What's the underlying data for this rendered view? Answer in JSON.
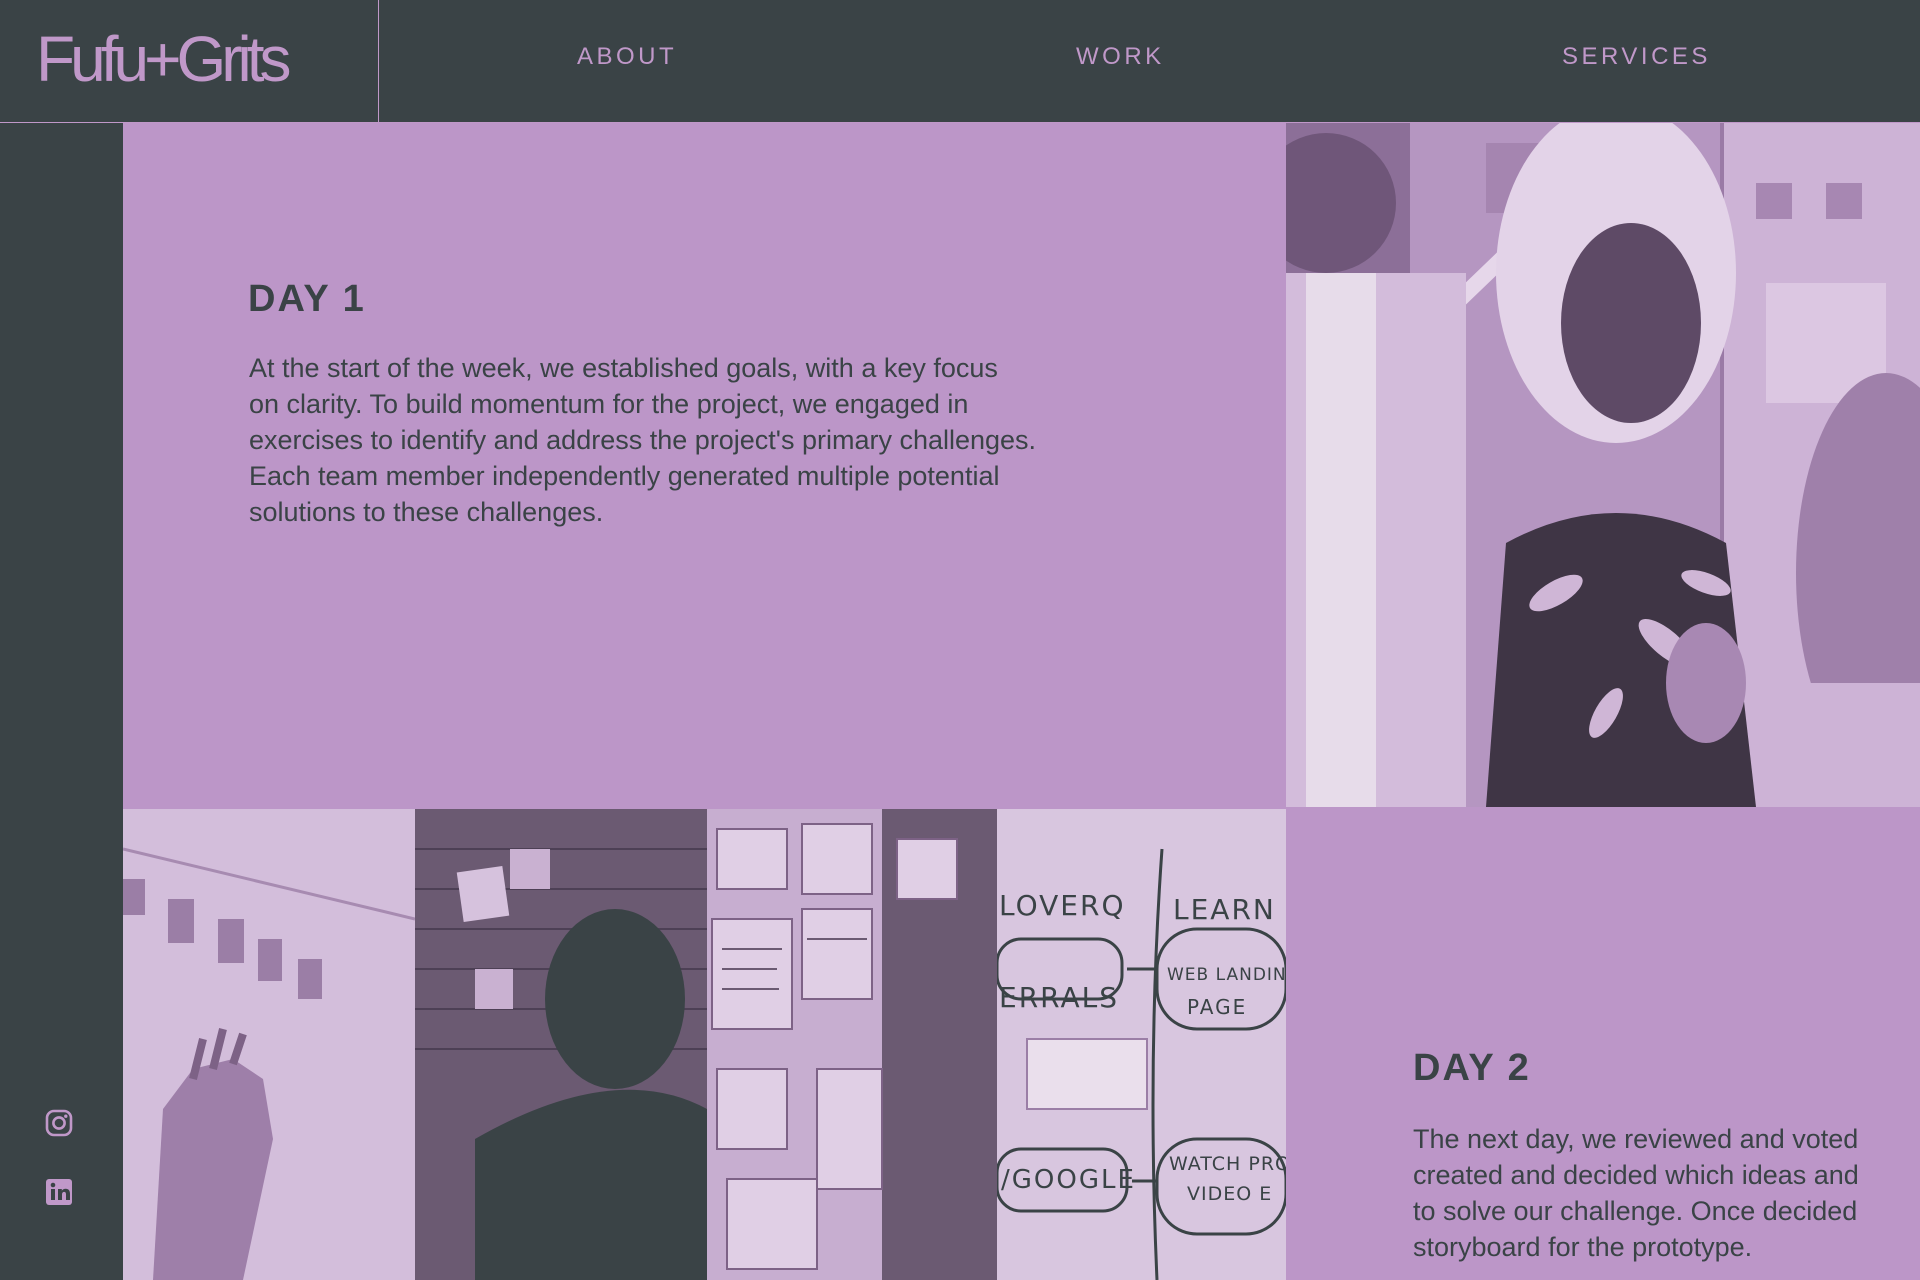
{
  "brand": {
    "logo": "Fufu+Grits"
  },
  "nav": {
    "items": [
      {
        "label": "ABOUT"
      },
      {
        "label": "WORK"
      },
      {
        "label": "SERVICES"
      }
    ]
  },
  "social": {
    "icons": [
      "instagram-icon",
      "linkedin-icon"
    ]
  },
  "days": [
    {
      "title": "DAY 1",
      "lines": [
        "At the start of the week, we established goals, with a key focus",
        "on clarity. To build momentum for the project, we engaged in",
        "exercises to identify and address the project's primary challenges.",
        "Each team member independently generated multiple potential",
        "solutions to these challenges."
      ]
    },
    {
      "title": "DAY 2",
      "lines": [
        "The next day, we reviewed and voted",
        "created and decided which ideas and",
        "to solve our challenge. Once decided",
        "storyboard for the prototype."
      ]
    }
  ],
  "whiteboard": {
    "words": [
      "LOVERQ",
      "LEARN",
      "ERRALS",
      "WEB LANDING",
      "PAGE",
      "/GOOGLE",
      "WATCH PRO",
      "VIDEO E"
    ]
  },
  "colors": {
    "dark": "#3a4346",
    "lilac": "#bc96c8",
    "accent": "#c098c9"
  }
}
